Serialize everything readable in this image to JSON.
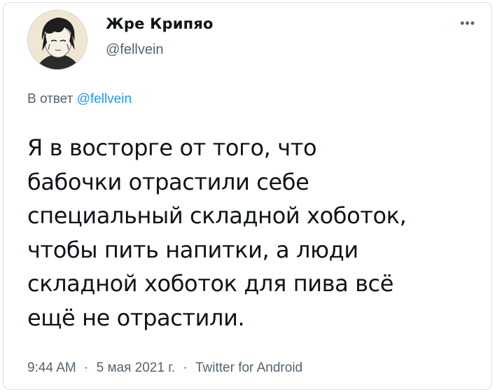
{
  "user": {
    "display_name": "Жре Крипяо",
    "handle": "@fellvein"
  },
  "more_icon": "more-horizontal-icon",
  "reply": {
    "prefix": "В ответ",
    "to": "@fellvein"
  },
  "tweet": {
    "lines": [
      "Я в восторге от того, что",
      "бабочки отрастили себе",
      "специальный складной хоботок,",
      "чтобы пить напитки, а люди",
      "складной хоботок для пива всё",
      "ещё не отрастили."
    ]
  },
  "meta": {
    "time": "9:44 AM",
    "separator": "·",
    "date": "5 мая 2021 г.",
    "source": "Twitter for Android"
  },
  "colors": {
    "accent": "#1d9bf0",
    "secondary_text": "#536471",
    "primary_text": "#0f1419"
  }
}
